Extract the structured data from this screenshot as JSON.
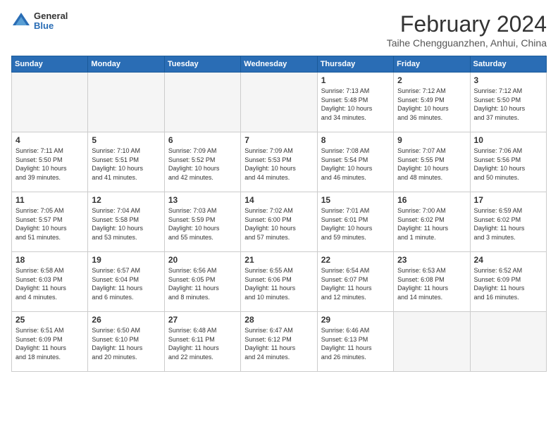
{
  "header": {
    "logo_general": "General",
    "logo_blue": "Blue",
    "month_title": "February 2024",
    "location": "Taihe Chengguanzhen, Anhui, China"
  },
  "days_of_week": [
    "Sunday",
    "Monday",
    "Tuesday",
    "Wednesday",
    "Thursday",
    "Friday",
    "Saturday"
  ],
  "weeks": [
    [
      {
        "day": "",
        "info": ""
      },
      {
        "day": "",
        "info": ""
      },
      {
        "day": "",
        "info": ""
      },
      {
        "day": "",
        "info": ""
      },
      {
        "day": "1",
        "info": "Sunrise: 7:13 AM\nSunset: 5:48 PM\nDaylight: 10 hours\nand 34 minutes."
      },
      {
        "day": "2",
        "info": "Sunrise: 7:12 AM\nSunset: 5:49 PM\nDaylight: 10 hours\nand 36 minutes."
      },
      {
        "day": "3",
        "info": "Sunrise: 7:12 AM\nSunset: 5:50 PM\nDaylight: 10 hours\nand 37 minutes."
      }
    ],
    [
      {
        "day": "4",
        "info": "Sunrise: 7:11 AM\nSunset: 5:50 PM\nDaylight: 10 hours\nand 39 minutes."
      },
      {
        "day": "5",
        "info": "Sunrise: 7:10 AM\nSunset: 5:51 PM\nDaylight: 10 hours\nand 41 minutes."
      },
      {
        "day": "6",
        "info": "Sunrise: 7:09 AM\nSunset: 5:52 PM\nDaylight: 10 hours\nand 42 minutes."
      },
      {
        "day": "7",
        "info": "Sunrise: 7:09 AM\nSunset: 5:53 PM\nDaylight: 10 hours\nand 44 minutes."
      },
      {
        "day": "8",
        "info": "Sunrise: 7:08 AM\nSunset: 5:54 PM\nDaylight: 10 hours\nand 46 minutes."
      },
      {
        "day": "9",
        "info": "Sunrise: 7:07 AM\nSunset: 5:55 PM\nDaylight: 10 hours\nand 48 minutes."
      },
      {
        "day": "10",
        "info": "Sunrise: 7:06 AM\nSunset: 5:56 PM\nDaylight: 10 hours\nand 50 minutes."
      }
    ],
    [
      {
        "day": "11",
        "info": "Sunrise: 7:05 AM\nSunset: 5:57 PM\nDaylight: 10 hours\nand 51 minutes."
      },
      {
        "day": "12",
        "info": "Sunrise: 7:04 AM\nSunset: 5:58 PM\nDaylight: 10 hours\nand 53 minutes."
      },
      {
        "day": "13",
        "info": "Sunrise: 7:03 AM\nSunset: 5:59 PM\nDaylight: 10 hours\nand 55 minutes."
      },
      {
        "day": "14",
        "info": "Sunrise: 7:02 AM\nSunset: 6:00 PM\nDaylight: 10 hours\nand 57 minutes."
      },
      {
        "day": "15",
        "info": "Sunrise: 7:01 AM\nSunset: 6:01 PM\nDaylight: 10 hours\nand 59 minutes."
      },
      {
        "day": "16",
        "info": "Sunrise: 7:00 AM\nSunset: 6:02 PM\nDaylight: 11 hours\nand 1 minute."
      },
      {
        "day": "17",
        "info": "Sunrise: 6:59 AM\nSunset: 6:02 PM\nDaylight: 11 hours\nand 3 minutes."
      }
    ],
    [
      {
        "day": "18",
        "info": "Sunrise: 6:58 AM\nSunset: 6:03 PM\nDaylight: 11 hours\nand 4 minutes."
      },
      {
        "day": "19",
        "info": "Sunrise: 6:57 AM\nSunset: 6:04 PM\nDaylight: 11 hours\nand 6 minutes."
      },
      {
        "day": "20",
        "info": "Sunrise: 6:56 AM\nSunset: 6:05 PM\nDaylight: 11 hours\nand 8 minutes."
      },
      {
        "day": "21",
        "info": "Sunrise: 6:55 AM\nSunset: 6:06 PM\nDaylight: 11 hours\nand 10 minutes."
      },
      {
        "day": "22",
        "info": "Sunrise: 6:54 AM\nSunset: 6:07 PM\nDaylight: 11 hours\nand 12 minutes."
      },
      {
        "day": "23",
        "info": "Sunrise: 6:53 AM\nSunset: 6:08 PM\nDaylight: 11 hours\nand 14 minutes."
      },
      {
        "day": "24",
        "info": "Sunrise: 6:52 AM\nSunset: 6:09 PM\nDaylight: 11 hours\nand 16 minutes."
      }
    ],
    [
      {
        "day": "25",
        "info": "Sunrise: 6:51 AM\nSunset: 6:09 PM\nDaylight: 11 hours\nand 18 minutes."
      },
      {
        "day": "26",
        "info": "Sunrise: 6:50 AM\nSunset: 6:10 PM\nDaylight: 11 hours\nand 20 minutes."
      },
      {
        "day": "27",
        "info": "Sunrise: 6:48 AM\nSunset: 6:11 PM\nDaylight: 11 hours\nand 22 minutes."
      },
      {
        "day": "28",
        "info": "Sunrise: 6:47 AM\nSunset: 6:12 PM\nDaylight: 11 hours\nand 24 minutes."
      },
      {
        "day": "29",
        "info": "Sunrise: 6:46 AM\nSunset: 6:13 PM\nDaylight: 11 hours\nand 26 minutes."
      },
      {
        "day": "",
        "info": ""
      },
      {
        "day": "",
        "info": ""
      }
    ]
  ]
}
